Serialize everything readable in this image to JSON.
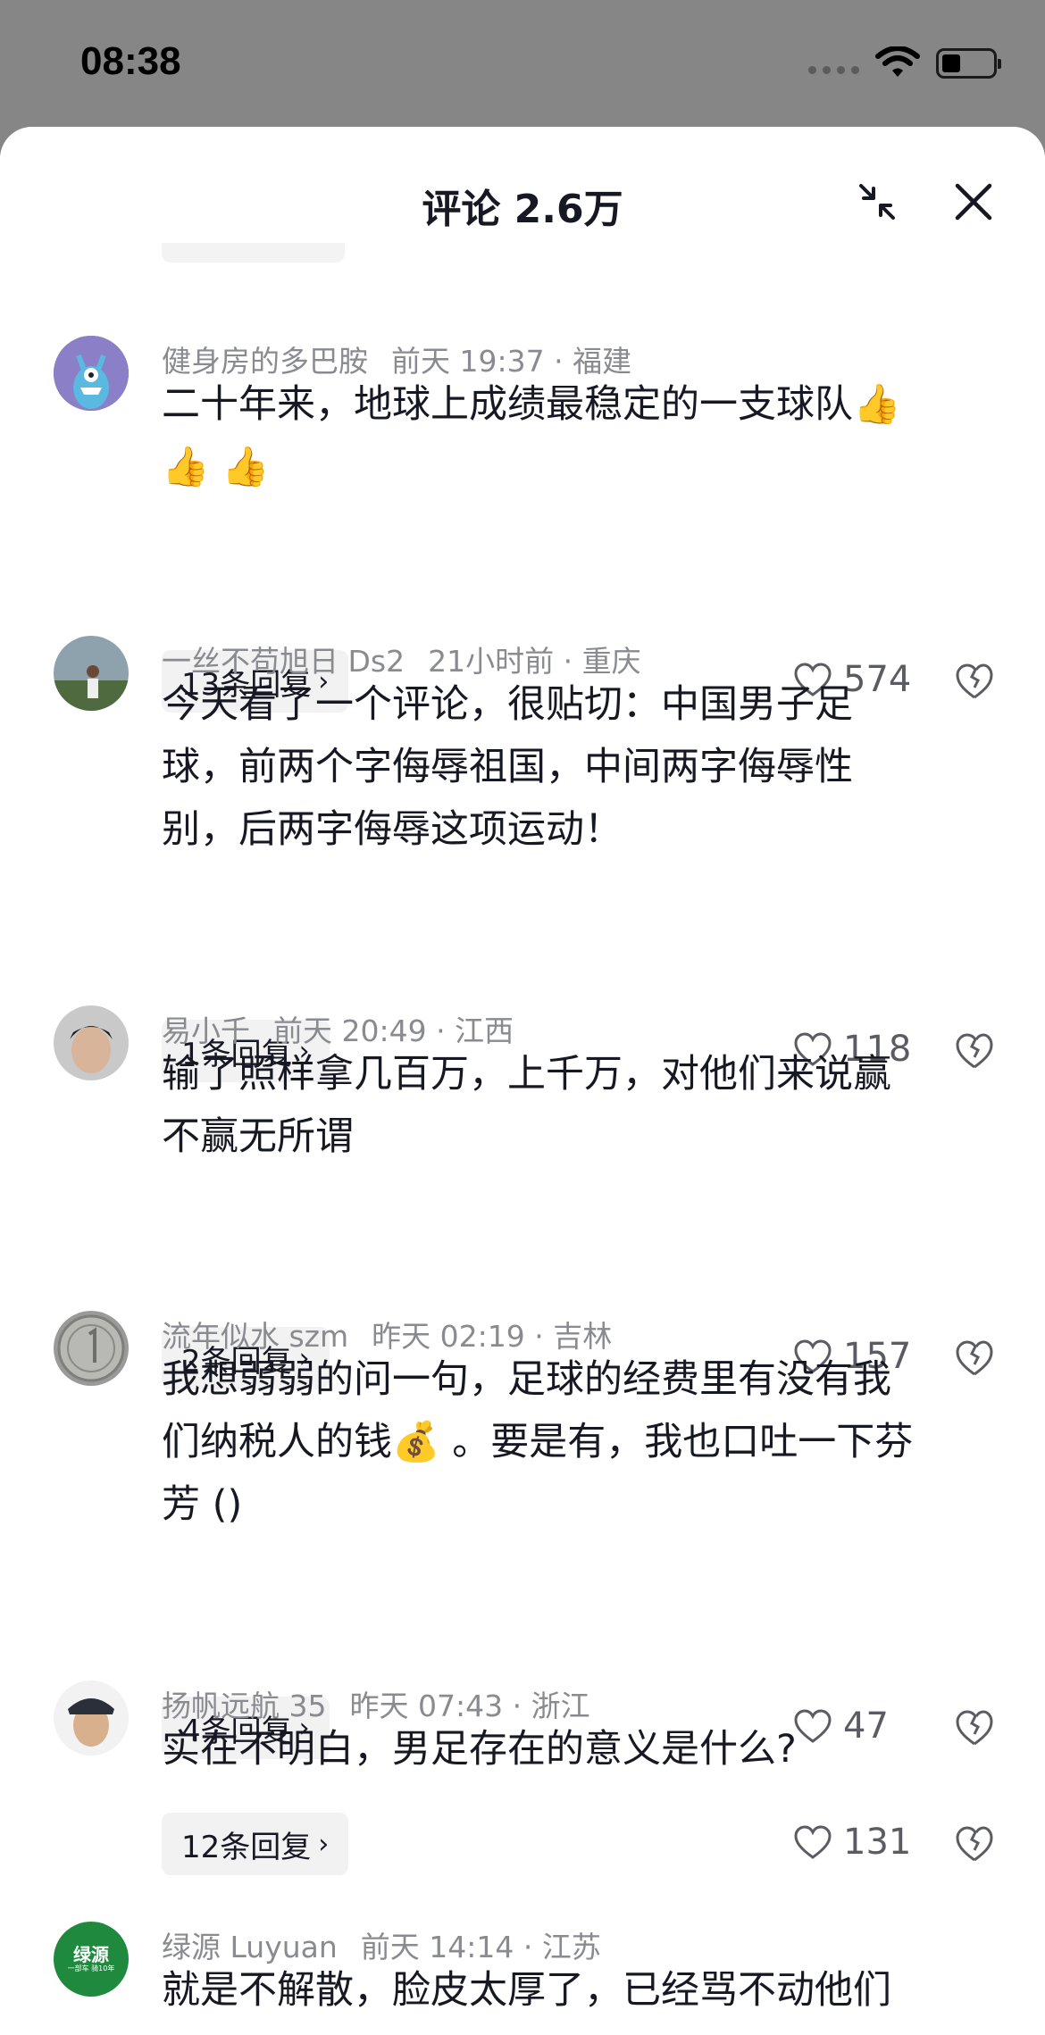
{
  "status_bar": {
    "time": "08:38"
  },
  "header": {
    "title": "评论 2.6万"
  },
  "comments": [
    {
      "user": "健身房的多巴胺",
      "time": "前天 19:37",
      "location": "福建",
      "text_lines": [
        "二十年来，地球上成绩最稳定的一支球队👍",
        "👍 👍"
      ],
      "replies": "13条回复",
      "likes": "574"
    },
    {
      "user": "一丝不苟旭日 Ds2",
      "time": "21小时前",
      "location": "重庆",
      "text_lines": [
        "今天看了一个评论，很贴切：中国男子足",
        "球，前两个字侮辱祖国，中间两字侮辱性",
        "别，后两字侮辱这项运动！"
      ],
      "replies": "1条回复",
      "likes": "118"
    },
    {
      "user": "易小千",
      "time": "前天 20:49",
      "location": "江西",
      "text_lines": [
        "输了照样拿几百万，上千万，对他们来说赢",
        "不赢无所谓"
      ],
      "replies": "2条回复",
      "likes": "157"
    },
    {
      "user": "流年似水 szm",
      "time": "昨天 02:19",
      "location": "吉林",
      "text_lines": [
        "我想弱弱的问一句，足球的经费里有没有我",
        "们纳税人的钱💰 。要是有，我也口吐一下芬",
        "芳 ()"
      ],
      "replies": "4条回复",
      "likes": "47"
    },
    {
      "user": "扬帆远航 35",
      "time": "昨天 07:43",
      "location": "浙江",
      "text_lines": [
        "实在不明白，男足存在的意义是什么?"
      ],
      "replies": "12条回复",
      "likes": "131"
    },
    {
      "user": "绿源 Luyuan",
      "time": "前天 14:14",
      "location": "江苏",
      "text_lines": [
        "就是不解散，脸皮太厚了，已经骂不动他们"
      ],
      "avatar_text": "绿源",
      "avatar_sub": "一部车 骑10年"
    }
  ],
  "separator": "·",
  "colors": {
    "accent_pill_bg": "#f2f2f3",
    "meta_gray": "#8a8b91",
    "text": "#161823",
    "avatar_green": "#1f8a3e"
  }
}
